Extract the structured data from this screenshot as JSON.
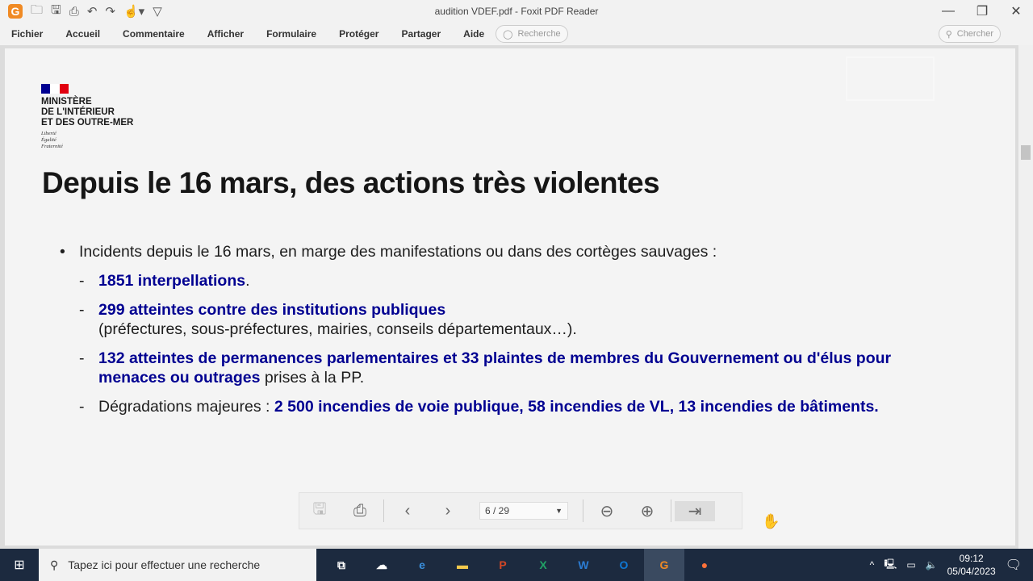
{
  "window": {
    "title": "audition VDEF.pdf - Foxit PDF Reader"
  },
  "menu": [
    "Fichier",
    "Accueil",
    "Commentaire",
    "Afficher",
    "Formulaire",
    "Protéger",
    "Partager",
    "Aide"
  ],
  "tell_me_placeholder": "Recherche",
  "search_placeholder": "Chercher",
  "slide": {
    "ministry": [
      "MINISTÈRE",
      "DE L'INTÉRIEUR",
      "ET DES OUTRE-MER"
    ],
    "motto": [
      "Liberté",
      "Égalité",
      "Fraternité"
    ],
    "title": "Depuis le 16 mars, des actions très violentes",
    "intro": "Incidents depuis le 16 mars, en marge des manifestations ou dans des cortèges sauvages :",
    "items": [
      {
        "bold": "1851 interpellations",
        "rest": "."
      },
      {
        "bold": "299 atteintes contre des institutions publiques",
        "rest": "(préfectures, sous-préfectures, mairies, conseils départementaux…)."
      },
      {
        "bold": "132 atteintes de permanences parlementaires et 33 plaintes de membres du Gouvernement ou d'élus pour menaces ou outrages",
        "rest": " prises à la PP."
      },
      {
        "pre": "Dégradations majeures : ",
        "bold": "2 500 incendies de voie publique, 58 incendies de VL, 13 incendies de bâtiments."
      }
    ]
  },
  "page_indicator": "6 / 29",
  "taskbar": {
    "search_placeholder": "Tapez ici pour effectuer une recherche",
    "time": "09:12",
    "date": "05/04/2023"
  },
  "colors": {
    "accent": "#000091",
    "taskbar": "#1c2a3f"
  }
}
